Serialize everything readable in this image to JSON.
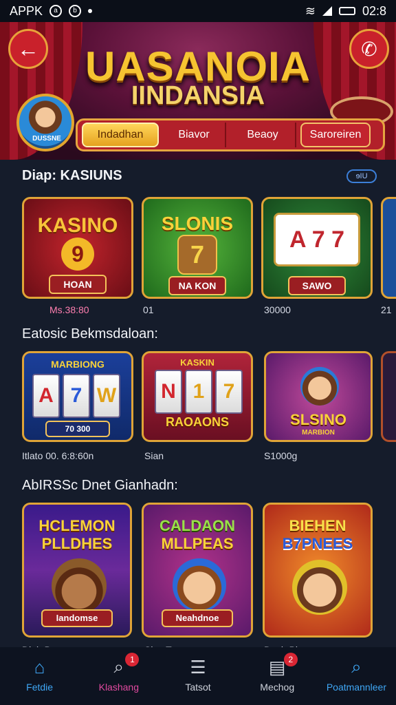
{
  "status_bar": {
    "app_label": "APPK",
    "time": "02:8"
  },
  "header": {
    "title_line1": "UASANOIA",
    "title_line2": "IINDANSIA",
    "avatar_label": "DUSSNE",
    "tabs": [
      "Indadhan",
      "Biavor",
      "Beaoy",
      "Saroreiren"
    ]
  },
  "section1": {
    "title": "Diap: KASIUNS",
    "pill": "ɘIU",
    "cards": [
      {
        "title": "KASINO",
        "number": "9",
        "button": "HOAN",
        "caption": "Ms.38:80"
      },
      {
        "title": "SLONIS",
        "number": "7",
        "button": "NA KON",
        "caption": "01"
      },
      {
        "title": "",
        "number": "A 7 7",
        "button": "SAWO",
        "caption": "30000"
      },
      {
        "caption": "21"
      }
    ]
  },
  "section2": {
    "title": "Eatosic Bekmsdaloan:",
    "cards": [
      {
        "title": "MARBIONG",
        "reels": [
          "A",
          "7",
          "W"
        ],
        "button": "70 300",
        "caption": "Itlato 00. 6:8:60n"
      },
      {
        "title": "KASKIN",
        "reels": [
          "N",
          "1",
          "7"
        ],
        "button": "RAOAONS",
        "caption": "Sian"
      },
      {
        "title": "SLSINO",
        "button": "MARBION",
        "caption": "S1000g"
      }
    ]
  },
  "section3": {
    "title": "AbIRSSc Dnet Gianhadn:",
    "cards": [
      {
        "title1": "HCLEMON",
        "title2": "PLLDHES",
        "button": "Iandomse",
        "caption": "Diab Bago"
      },
      {
        "title1": "CALDAON",
        "title2": "MLLPEAS",
        "button": "Neahdnoe",
        "caption": "Sies:Tam"
      },
      {
        "title1": "BIEHEN",
        "title2": "B7PNEES",
        "button": "",
        "caption": "Dasb Bigo"
      }
    ]
  },
  "bottom_nav": [
    {
      "label": "Fetdie",
      "icon": "home-icon",
      "color": "#3fa7f5"
    },
    {
      "label": "Klashang",
      "icon": "search-icon",
      "color": "#e24aa0",
      "badge": "1"
    },
    {
      "label": "Tatsot",
      "icon": "list-icon",
      "color": "#cfd3dc"
    },
    {
      "label": "Mechog",
      "icon": "document-icon",
      "color": "#cfd3dc",
      "badge": "2"
    },
    {
      "label": "Poatmannleer",
      "icon": "search-icon",
      "color": "#3fa7f5"
    }
  ]
}
